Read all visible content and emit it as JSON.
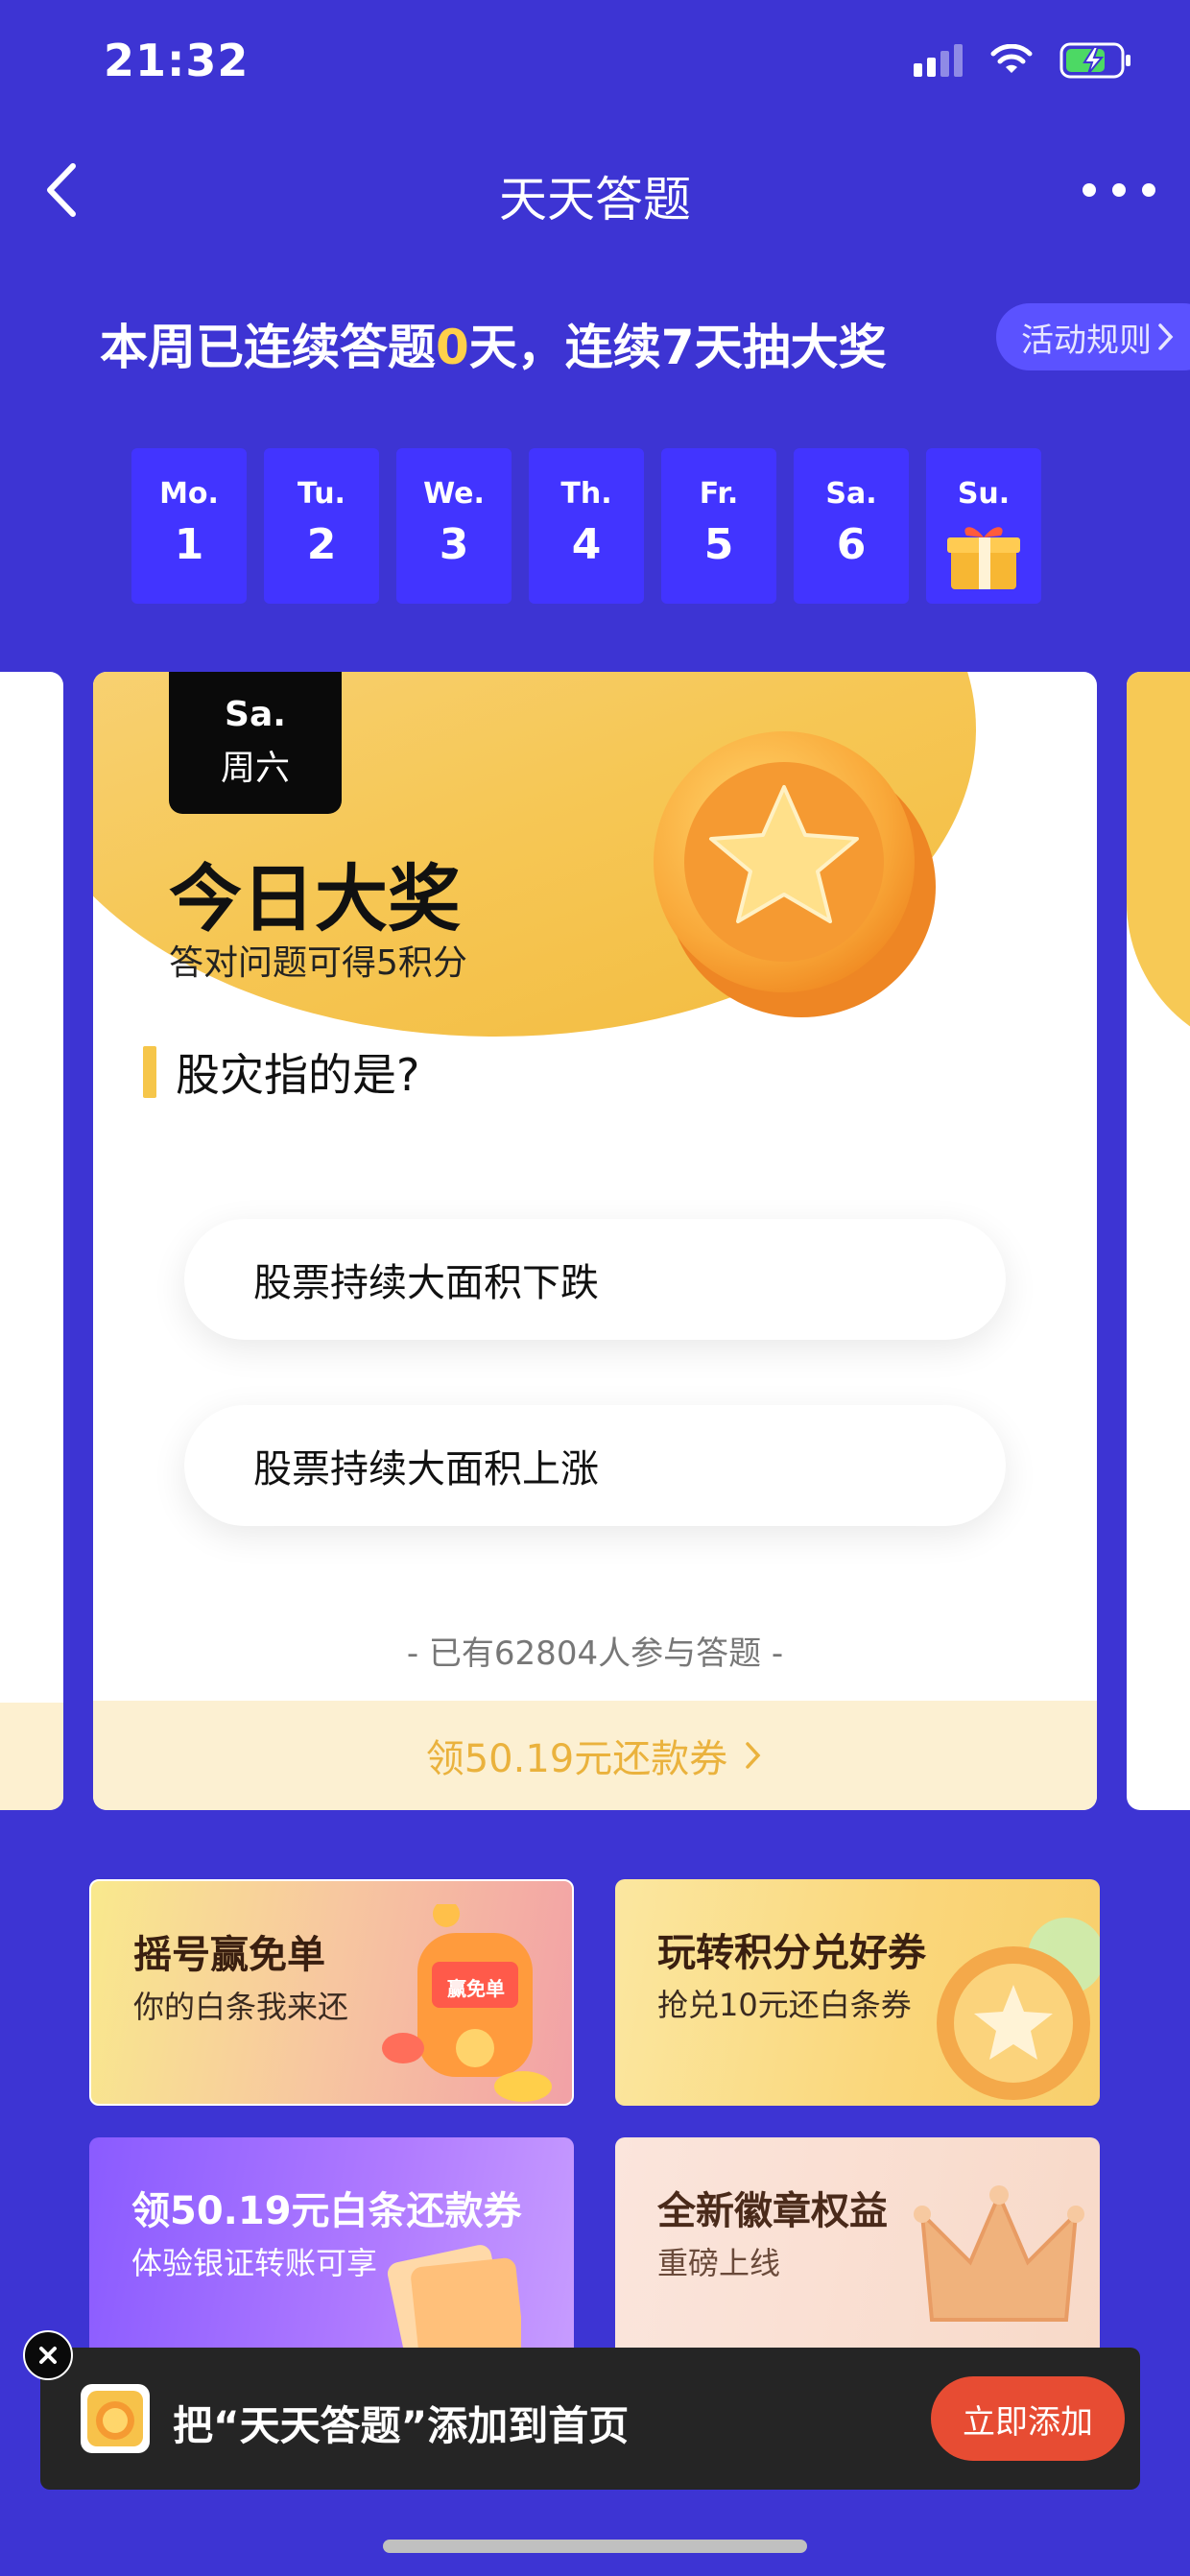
{
  "status_bar": {
    "time": "21:32"
  },
  "nav": {
    "title": "天天答题"
  },
  "streak": {
    "prefix": "本周已连续答题",
    "days": "0",
    "suffix": "天，连续7天抽大奖"
  },
  "rules_button": "活动规则",
  "week": [
    {
      "name": "Mo.",
      "date": "1"
    },
    {
      "name": "Tu.",
      "date": "2"
    },
    {
      "name": "We.",
      "date": "3"
    },
    {
      "name": "Th.",
      "date": "4"
    },
    {
      "name": "Fr.",
      "date": "5"
    },
    {
      "name": "Sa.",
      "date": "6"
    },
    {
      "name": "Su.",
      "icon": "gift-icon"
    }
  ],
  "card": {
    "day_en": "Sa.",
    "day_cn": "周六",
    "prize_title": "今日大奖",
    "prize_subtitle": "答对问题可得5积分",
    "question": "股灾指的是?",
    "options": [
      "股票持续大面积下跌",
      "股票持续大面积上涨"
    ],
    "participants": "- 已有62804人参与答题 -",
    "footer_link": "领50.19元还款券"
  },
  "tiles": [
    {
      "title": "摇号赢免单",
      "subtitle": "你的白条我来还",
      "badge": "赢免单"
    },
    {
      "title": "玩转积分兑好券",
      "subtitle": "抢兑10元还白条券"
    },
    {
      "title": "领50.19元白条还款券",
      "subtitle": "体验银证转账可享"
    },
    {
      "title": "全新徽章权益",
      "subtitle": "重磅上线"
    }
  ],
  "add_bar": {
    "text": "把“天天答题”添加到首页",
    "button": "立即添加"
  },
  "colors": {
    "background": "#3d34d3",
    "accent_yellow": "#ffd04a",
    "card_gold": "#f6c755",
    "add_button": "#e74c33"
  }
}
